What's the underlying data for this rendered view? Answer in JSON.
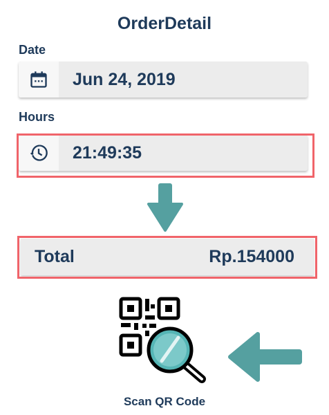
{
  "page": {
    "title": "OrderDetail"
  },
  "date": {
    "label": "Date",
    "value": "Jun 24, 2019",
    "icon": "calendar-icon"
  },
  "hours": {
    "label": "Hours",
    "value": "21:49:35",
    "icon": "history-icon"
  },
  "total": {
    "label": "Total",
    "value": "Rp.154000"
  },
  "scan": {
    "label": "Scan QR Code",
    "icon": "qr-scan-icon"
  },
  "colors": {
    "text": "#1e3a5a",
    "highlight": "#f0646a",
    "arrow": "#55a0a0",
    "field_bg": "#ececec"
  }
}
